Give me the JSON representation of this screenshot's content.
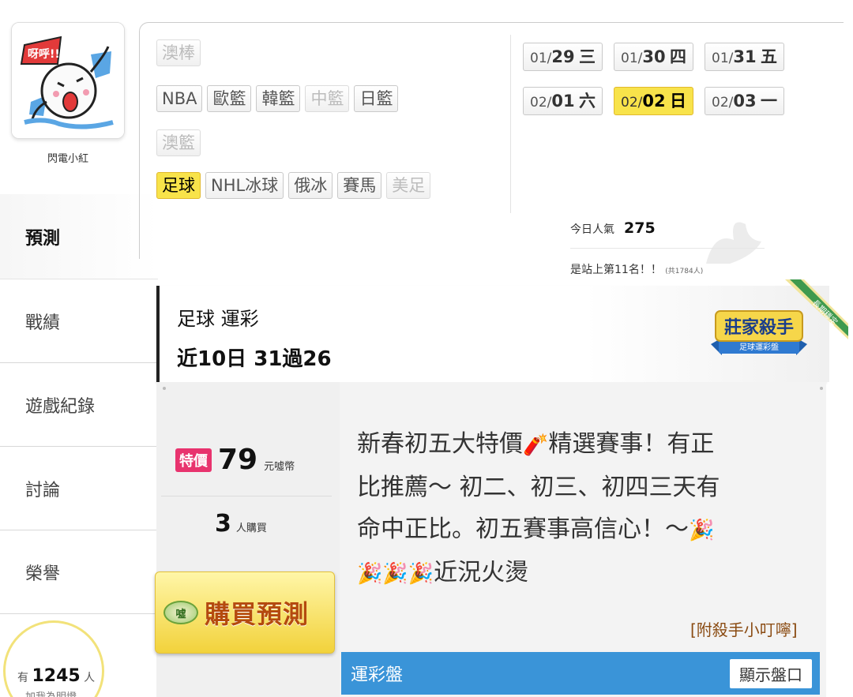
{
  "user": {
    "name": "閃電小紅",
    "avatar_caption": "呀呼!!"
  },
  "nav": {
    "items": [
      {
        "label": "預測",
        "active": true
      },
      {
        "label": "戰績",
        "active": false
      },
      {
        "label": "遊戲紀錄",
        "active": false
      },
      {
        "label": "討論",
        "active": false
      },
      {
        "label": "榮譽",
        "active": false
      }
    ]
  },
  "followers": {
    "prefix": "有",
    "count": "1245",
    "unit": "人",
    "subtitle": "加我為明燈"
  },
  "categories": {
    "rows": [
      [
        {
          "label": "澳棒",
          "state": "dim"
        }
      ],
      [
        {
          "label": "NBA",
          "state": "normal"
        },
        {
          "label": "歐籃",
          "state": "normal"
        },
        {
          "label": "韓籃",
          "state": "normal"
        },
        {
          "label": "中籃",
          "state": "dim"
        },
        {
          "label": "日籃",
          "state": "normal"
        }
      ],
      [
        {
          "label": "澳籃",
          "state": "dim"
        }
      ],
      [
        {
          "label": "足球",
          "state": "active"
        },
        {
          "label": "NHL冰球",
          "state": "normal"
        },
        {
          "label": "俄冰",
          "state": "normal"
        },
        {
          "label": "賽馬",
          "state": "normal"
        },
        {
          "label": "美足",
          "state": "dim"
        }
      ]
    ]
  },
  "dates": {
    "rows": [
      [
        {
          "md": "01/",
          "day": "29",
          "weekday": "三",
          "active": false
        },
        {
          "md": "01/",
          "day": "30",
          "weekday": "四",
          "active": false
        },
        {
          "md": "01/",
          "day": "31",
          "weekday": "五",
          "active": false
        }
      ],
      [
        {
          "md": "02/",
          "day": "01",
          "weekday": "六",
          "active": false
        },
        {
          "md": "02/",
          "day": "02",
          "weekday": "日",
          "active": true
        },
        {
          "md": "02/",
          "day": "03",
          "weekday": "一",
          "active": false
        }
      ]
    ]
  },
  "stats": {
    "popularity_label": "今日人氣",
    "popularity_value": "275",
    "rank_text": "是站上第11名！！",
    "rank_note": "(共1784人)"
  },
  "summary": {
    "title": "足球 運彩",
    "record": "近10日 31過26",
    "badge_title": "莊家殺手",
    "badge_sub": "足球運彩盤",
    "ribbon_text": "長期穩定"
  },
  "offer": {
    "sale_tag": "特價",
    "price": "79",
    "price_unit": "元噓幣",
    "buyers": "3",
    "buyers_unit": "人購買",
    "buy_button": "購買預測",
    "coin_label": "噓"
  },
  "description": {
    "line1": "新春初五大特價",
    "line1_emoji": "🧨",
    "line1_rest": "精選賽事！有正",
    "line2": "比推薦～ 初二、初三、初四三天有",
    "line3": "命中正比。初五賽事高信心！～",
    "line3_emoji": "🎉",
    "line4_emoji": "🎉🎉🎉",
    "line4": "近況火燙"
  },
  "tips_link": "[附殺手小叮嚀]",
  "table": {
    "title": "運彩盤",
    "show_button": "顯示盤口"
  },
  "colors": {
    "active_yellow": "#f8e34a",
    "sale_pink": "#e8336e",
    "table_blue": "#3a94d8",
    "link_brown": "#8a4b12"
  }
}
